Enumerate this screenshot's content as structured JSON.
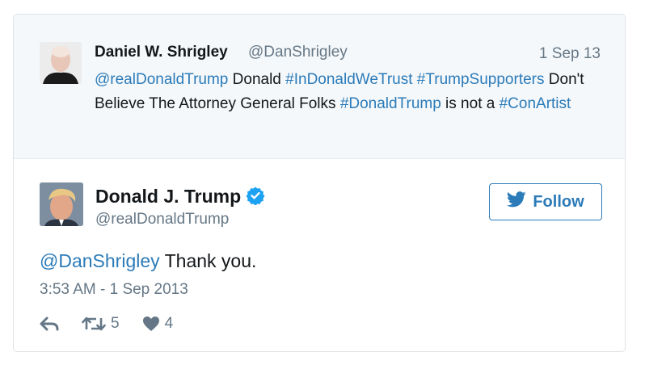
{
  "parent_tweet": {
    "name": "Daniel W. Shrigley",
    "handle": "@DanShrigley",
    "date": "1 Sep 13",
    "mention": "@realDonaldTrump",
    "text_1": " Donald ",
    "hashtag_1": "#InDonaldWeTrust",
    "text_2": " ",
    "hashtag_2": "#TrumpSupporters",
    "text_3": " Don't Believe The Attorney General Folks ",
    "hashtag_3": "#DonaldTrump",
    "text_4": " is not a ",
    "hashtag_4": "#ConArtist"
  },
  "tweet": {
    "name": "Donald J. Trump",
    "handle": "@realDonaldTrump",
    "follow_label": "Follow",
    "mention": "@DanShrigley",
    "text": " Thank you.",
    "timestamp": "3:53 AM - 1 Sep 2013",
    "retweets": "5",
    "likes": "4"
  },
  "colors": {
    "link": "#2b7bb9",
    "muted": "#657786",
    "verified": "#1da1f2"
  },
  "icons": {
    "reply": "reply-icon",
    "retweet": "retweet-icon",
    "like": "heart-icon",
    "verified": "verified-badge-icon",
    "bird": "twitter-bird-icon"
  }
}
